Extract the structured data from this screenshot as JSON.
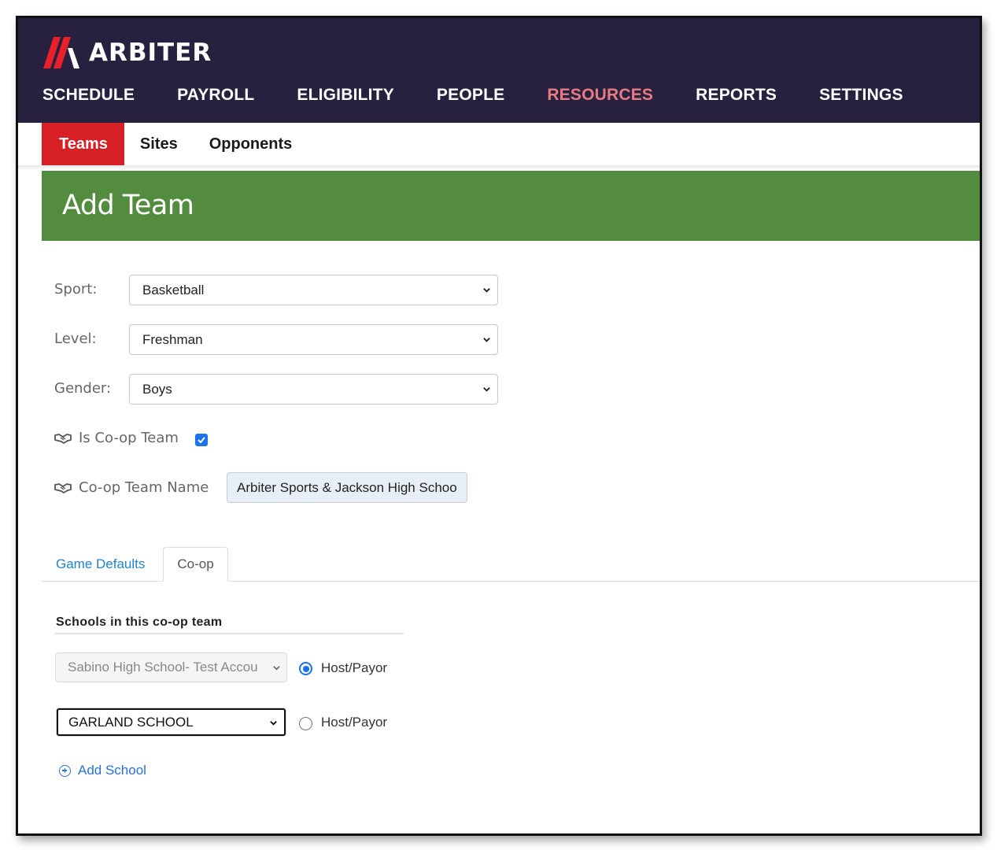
{
  "brand": {
    "name": "ARBITER",
    "accent": "#e8202a"
  },
  "nav": {
    "items": [
      "SCHEDULE",
      "PAYROLL",
      "ELIGIBILITY",
      "PEOPLE",
      "RESOURCES",
      "REPORTS",
      "SETTINGS"
    ],
    "active": "RESOURCES"
  },
  "subnav": {
    "items": [
      "Teams",
      "Sites",
      "Opponents"
    ],
    "active": "Teams"
  },
  "page": {
    "title": "Add Team"
  },
  "form": {
    "sport": {
      "label": "Sport:",
      "value": "Basketball"
    },
    "level": {
      "label": "Level:",
      "value": "Freshman"
    },
    "gender": {
      "label": "Gender:",
      "value": "Boys"
    },
    "is_coop": {
      "label": "Is Co-op Team",
      "checked": true
    },
    "coop_name": {
      "label": "Co-op Team Name",
      "value": "Arbiter Sports & Jackson High Schoo"
    }
  },
  "tabs": {
    "items": [
      "Game Defaults",
      "Co-op"
    ],
    "active": "Co-op"
  },
  "coop": {
    "section_title": "Schools in this co-op team",
    "schools": [
      {
        "value": "Sabino High School- Test Accou",
        "host_label": "Host/Payor",
        "host": true,
        "disabled": true
      },
      {
        "value": "GARLAND SCHOOL",
        "host_label": "Host/Payor",
        "host": false,
        "disabled": false
      }
    ],
    "add_label": "Add School"
  },
  "icons": {
    "logo": "arbiter-logo-icon",
    "dropdown": "chevron-down-icon",
    "handshake": "handshake-icon",
    "add": "plus-circle-icon",
    "checkmark": "checkmark-icon"
  },
  "colors": {
    "header_bg": "#27213f",
    "nav_active": "#e77b81",
    "subnav_active": "#d71f26",
    "banner": "#548c3f",
    "link": "#2184c9"
  }
}
